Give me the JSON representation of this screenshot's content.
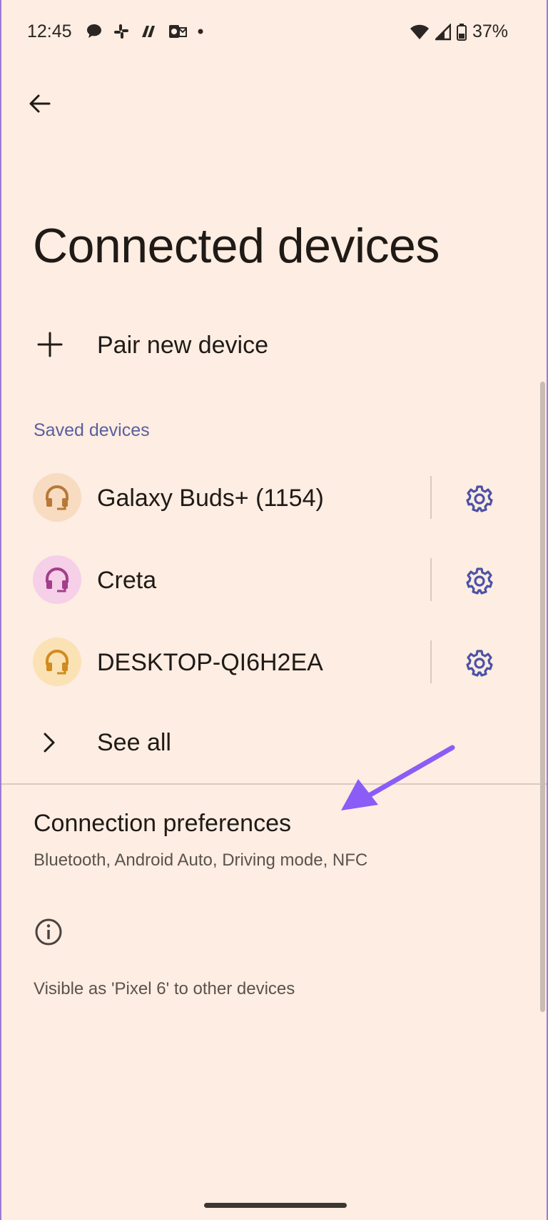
{
  "status_bar": {
    "time": "12:45",
    "notification_icons": [
      "chat-icon",
      "slack-icon",
      "app-icon",
      "outlook-icon",
      "dot-icon"
    ],
    "battery": "37%"
  },
  "header": {
    "title": "Connected devices"
  },
  "pair": {
    "label": "Pair new device"
  },
  "saved_devices": {
    "header": "Saved devices",
    "items": [
      {
        "label": "Galaxy Buds+ (1154)",
        "avatar_bg": "#f7dcc2",
        "icon_color": "#b87936"
      },
      {
        "label": "Creta",
        "avatar_bg": "#f6cfe8",
        "icon_color": "#a33f8a"
      },
      {
        "label": "DESKTOP-QI6H2EA",
        "avatar_bg": "#fbe2b5",
        "icon_color": "#d18b1f"
      }
    ]
  },
  "see_all": {
    "label": "See all"
  },
  "connection_preferences": {
    "title": "Connection preferences",
    "subtitle": "Bluetooth, Android Auto, Driving mode, NFC"
  },
  "footer": {
    "visible_as": "Visible as 'Pixel 6' to other devices"
  },
  "colors": {
    "background": "#fdede2",
    "accent": "#5a5f9f",
    "annotation_arrow": "#8b5cf6"
  }
}
